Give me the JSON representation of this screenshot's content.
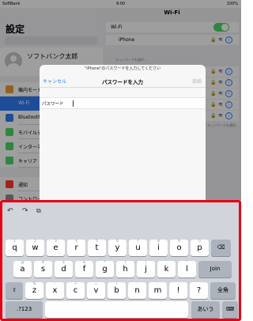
{
  "status_bar": {
    "carrier": "SoftBank",
    "time": "9:00",
    "battery": "100%"
  },
  "left_pane": {
    "title": "設定",
    "profile_name": "ソフトバンク太郎",
    "items": [
      {
        "label": "機内モード",
        "color": "#f19a37",
        "selected": false
      },
      {
        "label": "Wi-Fi",
        "color": "#2f7df6",
        "selected": true
      },
      {
        "label": "Bluetooth",
        "color": "#2f7df6",
        "selected": false
      },
      {
        "label": "モバイルデータ通信",
        "color": "#4cd964",
        "selected": false
      },
      {
        "label": "インターネット共有",
        "color": "#4cd964",
        "selected": false
      },
      {
        "label": "キャリア",
        "color": "#4cd964",
        "selected": false
      },
      {
        "label": "通知",
        "color": "#ff3b30",
        "selected": false
      },
      {
        "label": "コントロールセンター",
        "color": "#8e8e93",
        "selected": false
      },
      {
        "label": "おやすみモード",
        "color": "#5856d6",
        "selected": false
      }
    ]
  },
  "right_pane": {
    "title": "Wi-Fi",
    "wifi_label": "Wi-Fi",
    "selected_network": "iPhone",
    "network_caption": "ネットワークを選択...",
    "other_caption": "ネットワークを選択..."
  },
  "dialog": {
    "prompt": "\"iPhone\"のパスワードを入力してください",
    "cancel": "キャンセル",
    "title": "パスワードを入力",
    "join": "接続",
    "field_label": "パスワード",
    "field_value": ""
  },
  "keyboard": {
    "row1": [
      [
        "q",
        "1"
      ],
      [
        "w",
        "2"
      ],
      [
        "e",
        "3"
      ],
      [
        "r",
        "4"
      ],
      [
        "t",
        "5"
      ],
      [
        "y",
        "6"
      ],
      [
        "u",
        "7"
      ],
      [
        "i",
        "8"
      ],
      [
        "o",
        "9"
      ],
      [
        "p",
        "0"
      ]
    ],
    "row2": [
      [
        "a",
        "@"
      ],
      [
        "s",
        "#"
      ],
      [
        "d",
        "$"
      ],
      [
        "f",
        "&"
      ],
      [
        "g",
        "*"
      ],
      [
        "h",
        "("
      ],
      [
        "j",
        ")"
      ],
      [
        "k",
        "'"
      ],
      [
        "l",
        "\""
      ]
    ],
    "row3": [
      [
        "z",
        "%"
      ],
      [
        "x",
        "-"
      ],
      [
        "c",
        "+"
      ],
      [
        "v",
        "="
      ],
      [
        "b",
        "/"
      ],
      [
        "n",
        ";"
      ],
      [
        "m",
        ":"
      ],
      [
        "!",
        ","
      ],
      [
        "?",
        "."
      ]
    ],
    "join": "Join",
    "zenkaku": "全角",
    "numbers": ".?123",
    "kana": "あいう"
  },
  "colors": {
    "accent": "#2f7df6",
    "highlight_border": "#e60012",
    "toggle_on": "#4cd964"
  }
}
